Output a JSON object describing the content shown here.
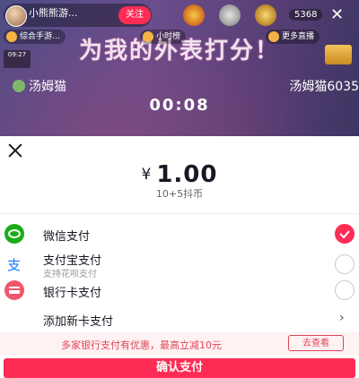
{
  "stream": {
    "host_name": "小熊熊游...",
    "host_likes": "",
    "follow_label": "关注",
    "viewer_count": "5368",
    "close_glyph": "✕",
    "badge_1": "综合手游…",
    "badge_2": "小时榜",
    "badge_3": "更多直播",
    "room_title": "为我的外表打分！",
    "timestamp": "09:27",
    "pk_left_name": "汤姆猫",
    "pk_right_name": "汤姆猫6035",
    "pk_timer": "00:08"
  },
  "payment": {
    "currency_symbol": "¥",
    "amount": "1.00",
    "coins_desc": "10+5抖币",
    "methods": [
      {
        "label": "微信支付",
        "sublabel": "",
        "icon": "wechat-pay-icon",
        "selected": true
      },
      {
        "label": "支付宝支付",
        "sublabel": "支持花呗支付",
        "icon": "alipay-icon",
        "selected": false
      },
      {
        "label": "银行卡支付",
        "sublabel": "",
        "icon": "bank-card-icon",
        "selected": false
      }
    ],
    "add_card_label": "添加新卡支付",
    "promo_text": "多家银行支付有优惠，最高立减10元",
    "promo_button": "去查看",
    "confirm_label": "确认支付"
  },
  "colors": {
    "accent": "#fe2c55",
    "wechat": "#1aad19",
    "alipay": "#1677ff",
    "bank": "#f0576a"
  }
}
